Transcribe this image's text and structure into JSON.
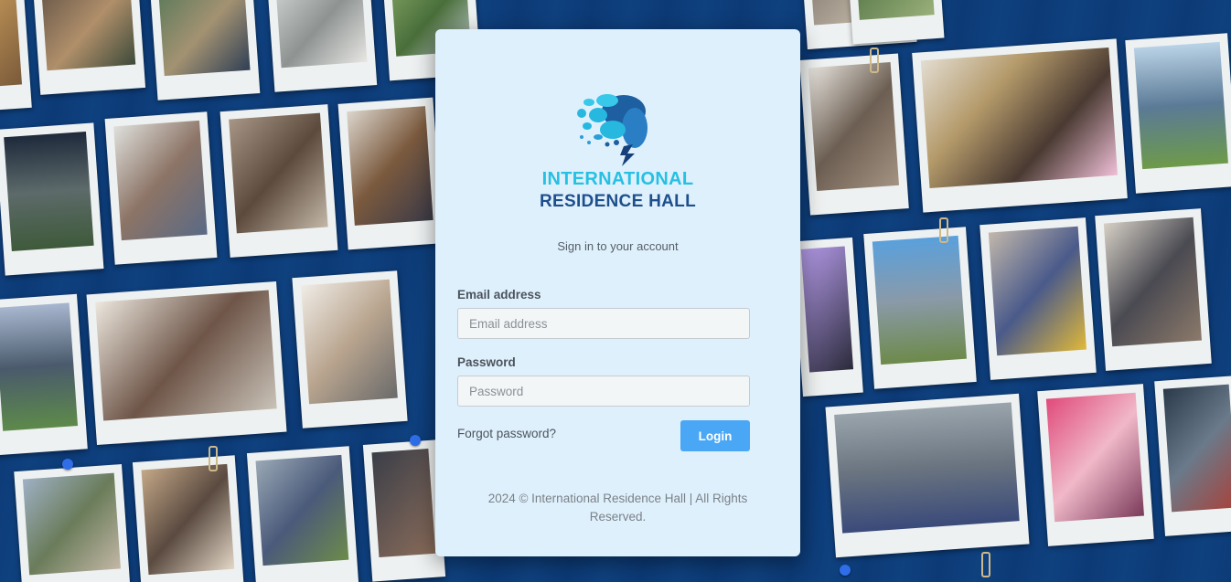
{
  "brand": {
    "line1": "INTERNATIONAL",
    "line2": "RESIDENCE HALL",
    "logo_icon": "globe-bubbles-icon",
    "colors": {
      "cyan": "#26c0e3",
      "navy": "#1d4f8c",
      "accent": "#4aa7f5"
    }
  },
  "login": {
    "subtitle": "Sign in to your account",
    "email_label": "Email address",
    "email_placeholder": "Email address",
    "password_label": "Password",
    "password_placeholder": "Password",
    "forgot_label": "Forgot password?",
    "login_label": "Login"
  },
  "footer": {
    "text": "2024 © International Residence Hall | All Rights Reserved."
  }
}
